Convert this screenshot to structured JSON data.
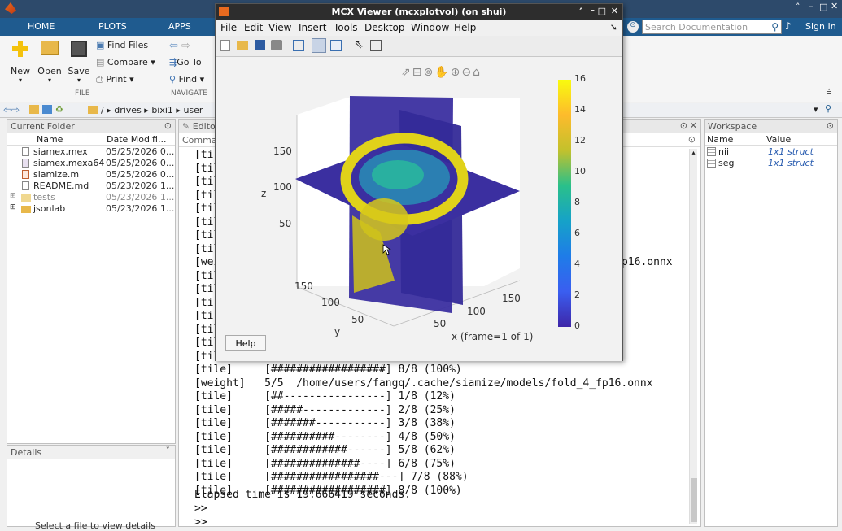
{
  "window": {
    "title": "MCX Viewer (mcxplotvol)  (on shui)"
  },
  "ribbon": {
    "tabs": [
      "HOME",
      "PLOTS",
      "APPS"
    ],
    "buttons": {
      "new": "New",
      "open": "Open",
      "save": "Save",
      "find_files": "Find Files",
      "compare": "Compare",
      "print": "Print",
      "goto": "Go To",
      "find": "Find"
    },
    "sections": {
      "file": "FILE",
      "navigate": "NAVIGATE"
    },
    "search_placeholder": "Search Documentation",
    "signin": "Sign In"
  },
  "address": {
    "segments": [
      "/",
      "drives",
      "bixi1",
      "user"
    ]
  },
  "current_folder": {
    "title": "Current Folder",
    "col_name": "Name",
    "col_date": "Date Modifi...",
    "files": [
      {
        "name": "siamex.mex",
        "date": "05/25/2026 0..."
      },
      {
        "name": "siamex.mexa64",
        "date": "05/25/2026 0..."
      },
      {
        "name": "siamize.m",
        "date": "05/25/2026 0..."
      },
      {
        "name": "README.md",
        "date": "05/23/2026 1..."
      },
      {
        "name": "tests",
        "date": "05/23/2026 1..."
      },
      {
        "name": "jsonlab",
        "date": "05/23/2026 1..."
      }
    ]
  },
  "details": {
    "title": "Details",
    "hint": "Select a file to view details"
  },
  "editor": {
    "tab": "Edito",
    "command_tab": "Comma"
  },
  "command_window": {
    "top_lines": [
      "[tile]",
      "[tile]",
      "[tile]",
      "[tile]",
      "[tile]",
      "[tile]",
      "[tile]",
      "[tile]",
      "[weight]",
      "[tile]",
      "[tile]",
      "[tile]",
      "[tile]",
      "[tile]",
      "[tile]",
      "[tile]",
      "[tile]"
    ],
    "partial_weight_suffix": "p16.onnx",
    "partial_line": "[tile]     [##################] 8/8 (100%)",
    "weight_line": "[weight]   5/5  /home/users/fangq/.cache/siamize/models/fold_4_fp16.onnx",
    "tile_lines": [
      "[tile]     [##----------------] 1/8 (12%)",
      "[tile]     [#####-------------] 2/8 (25%)",
      "[tile]     [#######-----------] 3/8 (38%)",
      "[tile]     [##########--------] 4/8 (50%)",
      "[tile]     [############------] 5/8 (62%)",
      "[tile]     [##############----] 6/8 (75%)",
      "[tile]     [#################---] 7/8 (88%)",
      "[tile]     [##################] 8/8 (100%)"
    ],
    "elapsed": "Elapsed time is 19.666419 seconds.",
    "prompt": ">>"
  },
  "workspace": {
    "title": "Workspace",
    "col_name": "Name",
    "col_value": "Value",
    "vars": [
      {
        "name": "nii",
        "value": "1x1 struct"
      },
      {
        "name": "seg",
        "value": "1x1 struct"
      }
    ]
  },
  "figure": {
    "menu": [
      "File",
      "Edit",
      "View",
      "Insert",
      "Tools",
      "Desktop",
      "Window",
      "Help"
    ],
    "help_button": "Help",
    "z_label": "z",
    "y_label": "y",
    "x_label": "x (frame=1 of 1)",
    "z_ticks": [
      "150",
      "100",
      "50"
    ],
    "y_ticks": [
      "150",
      "100",
      "50"
    ],
    "x_ticks": [
      "150",
      "100",
      "50"
    ],
    "colorbar_ticks": [
      "16",
      "14",
      "12",
      "10",
      "8",
      "6",
      "4",
      "2",
      "0"
    ]
  },
  "colors": {
    "title": "#2d4a6b",
    "ribbon_tab": "#1f5b8f",
    "slice": "#3b2fa0",
    "yellow": "#e0d21a",
    "teal": "#29b0a0"
  }
}
